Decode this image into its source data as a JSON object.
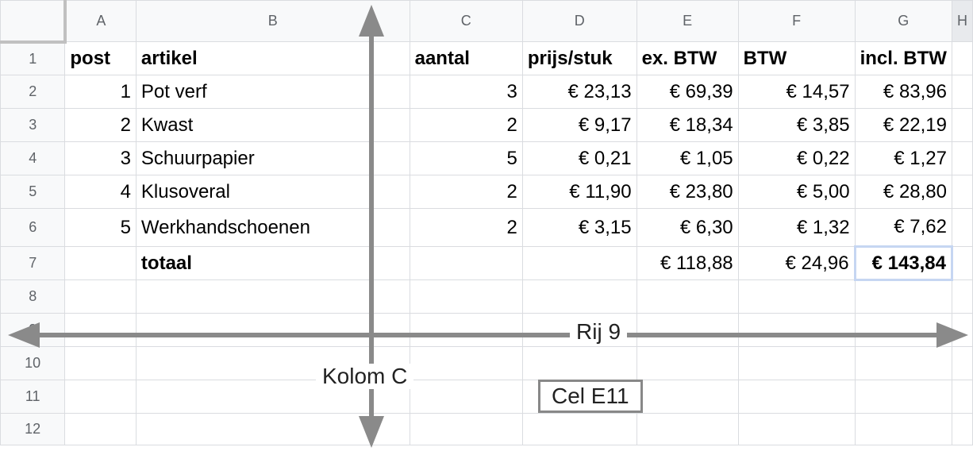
{
  "columns": [
    "A",
    "B",
    "C",
    "D",
    "E",
    "F",
    "G",
    "H"
  ],
  "rows": [
    {
      "num": "1",
      "cells": [
        "post",
        "artikel",
        "aantal",
        "prijs/stuk",
        "ex. BTW",
        "BTW",
        "incl. BTW",
        ""
      ]
    },
    {
      "num": "2",
      "cells": [
        "1",
        "Pot verf",
        "3",
        "€ 23,13",
        "€ 69,39",
        "€ 14,57",
        "€ 83,96",
        ""
      ]
    },
    {
      "num": "3",
      "cells": [
        "2",
        "Kwast",
        "2",
        "€ 9,17",
        "€ 18,34",
        "€ 3,85",
        "€ 22,19",
        ""
      ]
    },
    {
      "num": "4",
      "cells": [
        "3",
        "Schuurpapier",
        "5",
        "€ 0,21",
        "€ 1,05",
        "€ 0,22",
        "€ 1,27",
        ""
      ]
    },
    {
      "num": "5",
      "cells": [
        "4",
        "Klusoveral",
        "2",
        "€ 11,90",
        "€ 23,80",
        "€ 5,00",
        "€ 28,80",
        ""
      ]
    },
    {
      "num": "6",
      "cells": [
        "5",
        "Werkhandschoenen",
        "2",
        "€ 3,15",
        "€ 6,30",
        "€ 1,32",
        "€ 7,62",
        ""
      ]
    },
    {
      "num": "7",
      "cells": [
        "",
        "totaal",
        "",
        "",
        "€ 118,88",
        "€ 24,96",
        "€ 143,84",
        ""
      ]
    },
    {
      "num": "8",
      "cells": [
        "",
        "",
        "",
        "",
        "",
        "",
        "",
        ""
      ]
    },
    {
      "num": "9",
      "cells": [
        "",
        "",
        "",
        "",
        "",
        "",
        "",
        ""
      ]
    },
    {
      "num": "10",
      "cells": [
        "",
        "",
        "",
        "",
        "",
        "",
        "",
        ""
      ]
    },
    {
      "num": "11",
      "cells": [
        "",
        "",
        "",
        "",
        "",
        "",
        "",
        ""
      ]
    },
    {
      "num": "12",
      "cells": [
        "",
        "",
        "",
        "",
        "",
        "",
        "",
        ""
      ]
    }
  ],
  "annotations": {
    "row_label": "Rij 9",
    "column_label": "Kolom C",
    "cell_label": "Cel E11"
  },
  "colors": {
    "arrow": "#8a8a8a",
    "selection": "#c6d6f2"
  }
}
